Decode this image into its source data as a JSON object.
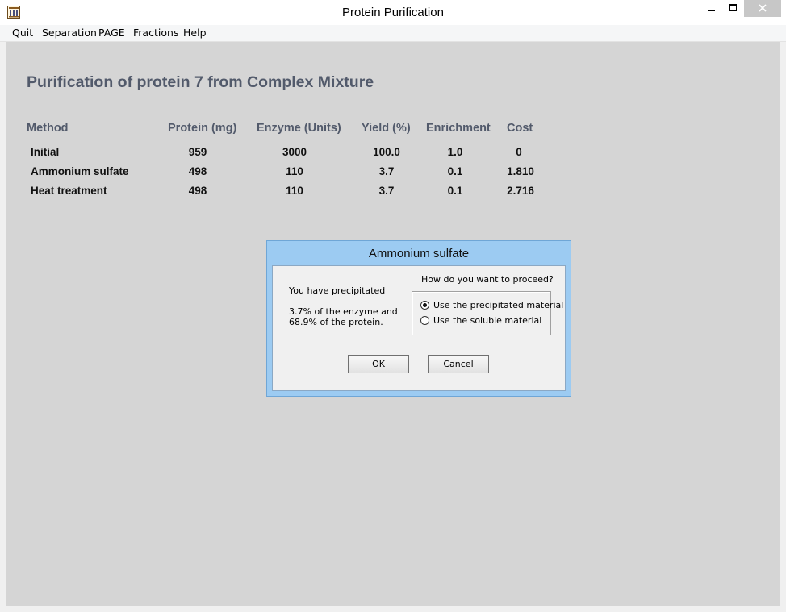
{
  "window": {
    "title": "Protein Purification"
  },
  "menu": [
    "Quit",
    "Separation",
    "PAGE",
    "Fractions",
    "Help"
  ],
  "heading": "Purification of protein 7 from Complex Mixture",
  "table": {
    "columns": [
      "Method",
      "Protein (mg)",
      "Enzyme (Units)",
      "Yield (%)",
      "Enrichment",
      "Cost"
    ],
    "rows": [
      [
        "Initial",
        "959",
        "3000",
        "100.0",
        "1.0",
        "0"
      ],
      [
        "Ammonium sulfate",
        "498",
        "110",
        "3.7",
        "0.1",
        "1.810"
      ],
      [
        "Heat treatment",
        "498",
        "110",
        "3.7",
        "0.1",
        "2.716"
      ]
    ]
  },
  "dialog": {
    "title": "Ammonium sulfate",
    "message_line1": "You have precipitated",
    "message_line2": "3.7% of the enzyme and",
    "message_line3": "68.9% of the protein.",
    "question": "How do you want to proceed?",
    "options": [
      {
        "label": "Use the precipitated material",
        "selected": true
      },
      {
        "label": "Use the soluble material",
        "selected": false
      }
    ],
    "ok_label": "OK",
    "cancel_label": "Cancel"
  },
  "colors": {
    "heading": "#525a6b",
    "client_bg": "#d5d5d5",
    "dialog_frame": "#9ccbf2"
  },
  "icons": {
    "app": "columns-app-icon",
    "minimize": "minimize-icon",
    "maximize": "maximize-icon",
    "close": "close-icon"
  }
}
